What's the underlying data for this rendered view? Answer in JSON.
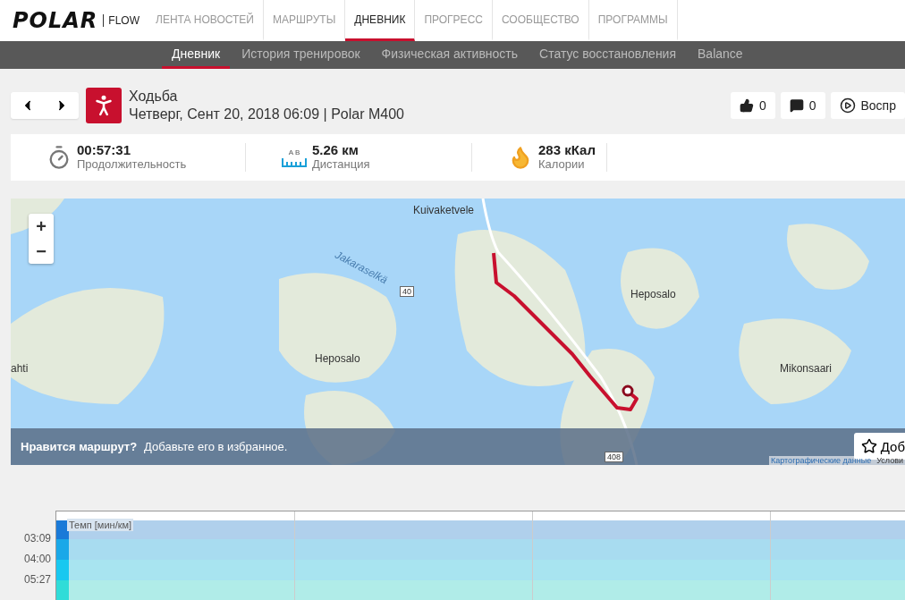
{
  "brand": {
    "logo": "POLAR",
    "flow": "FLOW"
  },
  "nav": [
    {
      "label": "ЛЕНТА НОВОСТЕЙ",
      "selected": false
    },
    {
      "label": "МАРШРУТЫ",
      "selected": false
    },
    {
      "label": "ДНЕВНИК",
      "selected": true
    },
    {
      "label": "ПРОГРЕСС",
      "selected": false
    },
    {
      "label": "СООБЩЕСТВО",
      "selected": false
    },
    {
      "label": "ПРОГРАММЫ",
      "selected": false
    }
  ],
  "subnav": [
    {
      "label": "Дневник",
      "selected": true
    },
    {
      "label": "История тренировок",
      "selected": false
    },
    {
      "label": "Физическая активность",
      "selected": false
    },
    {
      "label": "Статус восстановления",
      "selected": false
    },
    {
      "label": "Balance",
      "selected": false
    }
  ],
  "session": {
    "sport": "Ходьба",
    "date": "Четверг, Сент 20, 2018 06:09 | Polar M400"
  },
  "actions": [
    {
      "kind": "like",
      "label": "0"
    },
    {
      "kind": "comment",
      "label": "0"
    },
    {
      "kind": "play",
      "label": "Воспр"
    }
  ],
  "stats": [
    {
      "kind": "duration",
      "value": "00:57:31",
      "label": "Продолжительность"
    },
    {
      "kind": "distance",
      "value": "5.26 км",
      "label": "Дистанция",
      "marks": [
        "A",
        "B"
      ]
    },
    {
      "kind": "calories",
      "value": "283 кКал",
      "label": "Калории"
    }
  ],
  "map": {
    "zoom_in": "+",
    "zoom_out": "−",
    "places": [
      {
        "kind": "place",
        "name": "Kuivaketvele"
      },
      {
        "kind": "water",
        "name": "Jakaraselkä"
      },
      {
        "kind": "road",
        "name": "40"
      },
      {
        "kind": "place",
        "name": "Heposalo"
      },
      {
        "kind": "place",
        "name": "Heposalo"
      },
      {
        "kind": "place",
        "name": "ahti"
      },
      {
        "kind": "place",
        "name": "Mikonsaari"
      },
      {
        "kind": "road",
        "name": "408"
      }
    ],
    "banner": {
      "question": "Нравится маршрут?",
      "text": "Добавьте его в избранное.",
      "button": "Доб"
    },
    "attribution": "Картографические данные",
    "terms": "Услови"
  },
  "chart": {
    "legend": "Темп [мин/км]",
    "y_labels": [
      "03:09",
      "04:00",
      "05:27"
    ]
  }
}
